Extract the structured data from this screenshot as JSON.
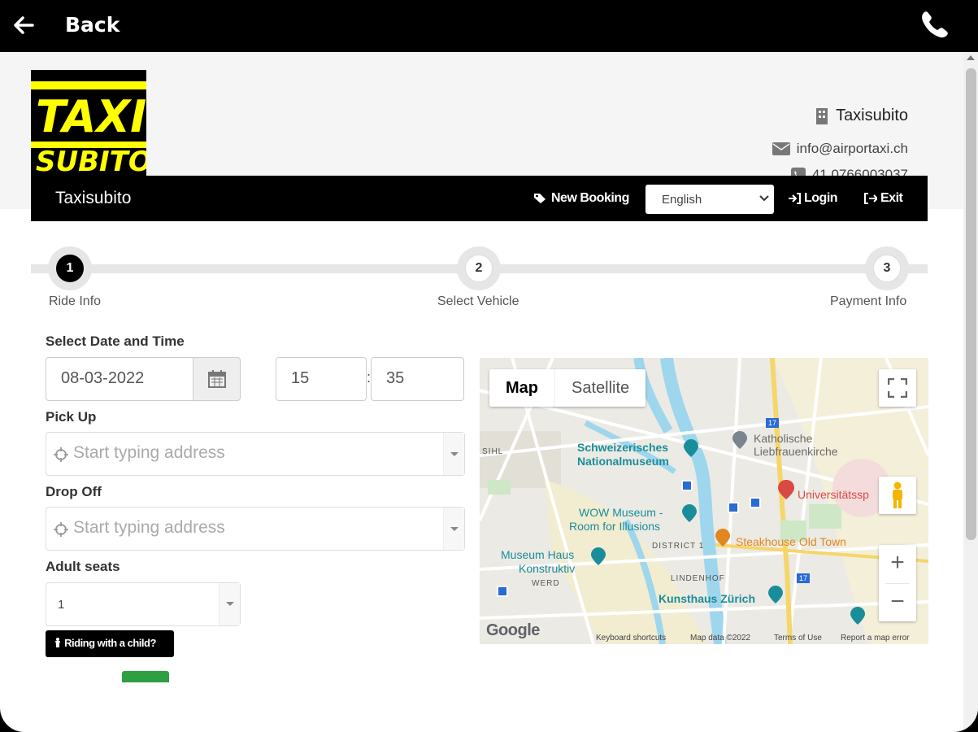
{
  "topbar": {
    "back_label": "Back",
    "icons": {
      "back": "arrow-left-icon",
      "phone": "phone-icon"
    }
  },
  "header": {
    "logo": {
      "line1": "TAXI",
      "line2": "SUBITO",
      "colors": {
        "bg": "#000000",
        "yellow": "#ffff00"
      }
    },
    "company_name": "Taxisubito",
    "email": "info@airportaxi.ch",
    "phone": "41 0766003037"
  },
  "navbar": {
    "brand": "Taxisubito",
    "new_booking": "New Booking",
    "language": {
      "selected": "English"
    },
    "login": "Login",
    "exit": "Exit"
  },
  "steps": [
    {
      "number": "1",
      "label": "Ride Info",
      "active": true
    },
    {
      "number": "2",
      "label": "Select Vehicle",
      "active": false
    },
    {
      "number": "3",
      "label": "Payment Info",
      "active": false
    }
  ],
  "form": {
    "date_time_label": "Select Date and Time",
    "date_value": "08-03-2022",
    "hour_value": "15",
    "minute_value": "35",
    "time_separator": ":",
    "pickup_label": "Pick Up",
    "pickup_placeholder": "Start typing address",
    "dropoff_label": "Drop Off",
    "dropoff_placeholder": "Start typing address",
    "adult_seats_label": "Adult seats",
    "adult_seats_value": "1",
    "child_button": "Riding with a child?"
  },
  "map": {
    "tabs": [
      "Map",
      "Satellite"
    ],
    "selected_tab": "Map",
    "labels": {
      "museum_line1": "Schweizerisches",
      "museum_line2": "Nationalmuseum",
      "church_line1": "Katholische",
      "church_line2": "Liebfrauenkirche",
      "hospital": "Universitätssp",
      "wow_line1": "WOW Museum -",
      "wow_line2": "Room for Illusions",
      "steakhouse": "Steakhouse Old Town",
      "district": "DISTRICT 1",
      "lindenhof": "LINDENHOF",
      "haus_line1": "Museum Haus",
      "haus_line2": "Konstruktiv",
      "werd": "WERD",
      "kunsthaus": "Kunsthaus Zürich",
      "sihl": "SIHL",
      "route": "17",
      "google": "Google"
    },
    "footer": {
      "shortcuts": "Keyboard shortcuts",
      "data": "Map data ©2022",
      "terms": "Terms of Use",
      "report": "Report a map error"
    },
    "zoom_in": "+",
    "zoom_out": "−"
  }
}
